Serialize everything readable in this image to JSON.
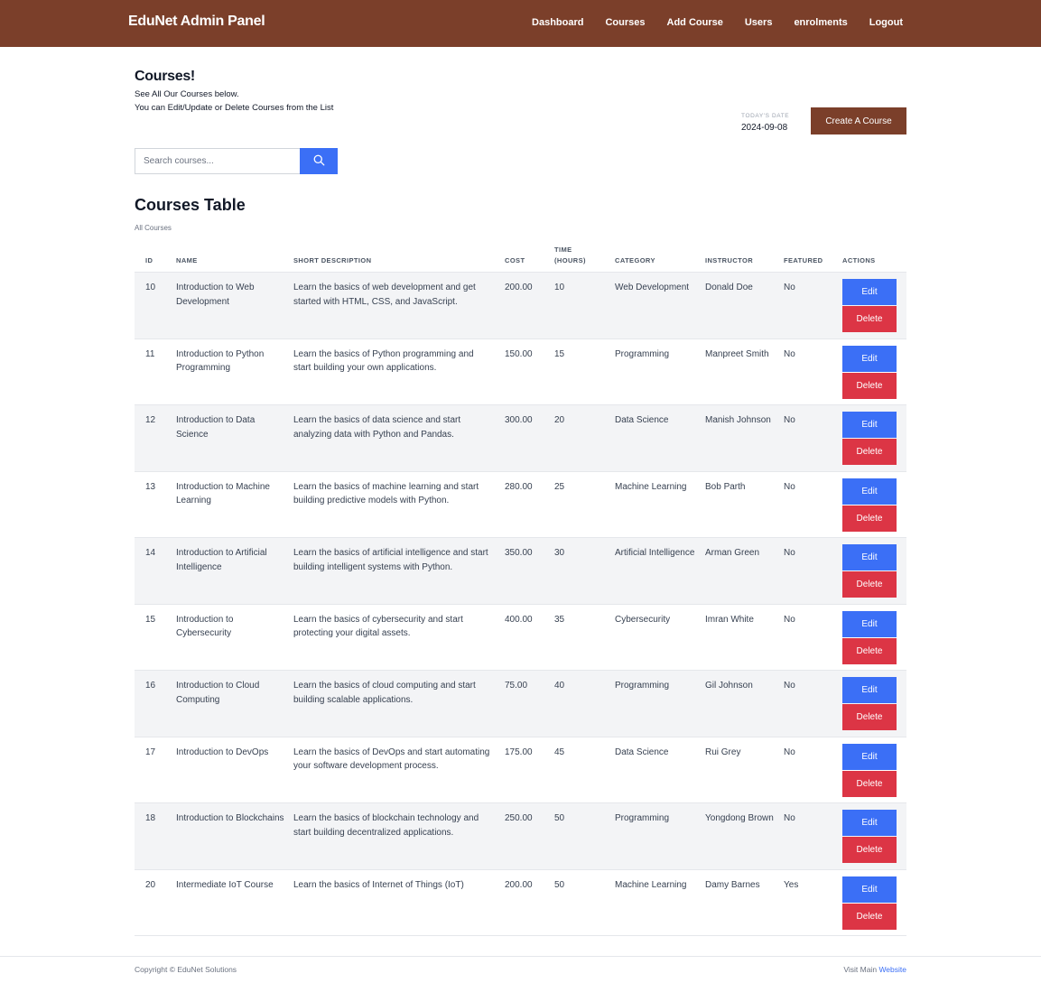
{
  "navbar": {
    "brand": "EduNet Admin Panel",
    "links": [
      "Dashboard",
      "Courses",
      "Add Course",
      "Users",
      "enrolments",
      "Logout"
    ]
  },
  "header": {
    "title": "Courses!",
    "subtitle_1": "See All Our Courses below.",
    "subtitle_2": "You can Edit/Update or Delete Courses from the List",
    "date_label": "Today's Date",
    "date_value": "2024-09-08",
    "create_button": "Create A Course"
  },
  "search": {
    "placeholder": "Search courses...",
    "icon": "search-icon"
  },
  "table": {
    "title": "Courses Table",
    "subtitle": "All Courses",
    "columns": [
      "ID",
      "Name",
      "Short Description",
      "Cost",
      "Time (Hours)",
      "Category",
      "Instructor",
      "Featured",
      "Actions"
    ],
    "edit_label": "Edit",
    "delete_label": "Delete",
    "rows": [
      {
        "id": "10",
        "name": "Introduction to Web Development",
        "desc": "Learn the basics of web development and get started with HTML, CSS, and JavaScript.",
        "cost": "200.00",
        "time": "10",
        "category": "Web Development",
        "instructor": "Donald Doe",
        "featured": "No"
      },
      {
        "id": "11",
        "name": "Introduction to Python Programming",
        "desc": "Learn the basics of Python programming and start building your own applications.",
        "cost": "150.00",
        "time": "15",
        "category": "Programming",
        "instructor": "Manpreet Smith",
        "featured": "No"
      },
      {
        "id": "12",
        "name": "Introduction to Data Science",
        "desc": "Learn the basics of data science and start analyzing data with Python and Pandas.",
        "cost": "300.00",
        "time": "20",
        "category": "Data Science",
        "instructor": "Manish Johnson",
        "featured": "No"
      },
      {
        "id": "13",
        "name": "Introduction to Machine Learning",
        "desc": "Learn the basics of machine learning and start building predictive models with Python.",
        "cost": "280.00",
        "time": "25",
        "category": "Machine Learning",
        "instructor": "Bob Parth",
        "featured": "No"
      },
      {
        "id": "14",
        "name": "Introduction to Artificial Intelligence",
        "desc": "Learn the basics of artificial intelligence and start building intelligent systems with Python.",
        "cost": "350.00",
        "time": "30",
        "category": "Artificial Intelligence",
        "instructor": "Arman Green",
        "featured": "No"
      },
      {
        "id": "15",
        "name": "Introduction to Cybersecurity",
        "desc": "Learn the basics of cybersecurity and start protecting your digital assets.",
        "cost": "400.00",
        "time": "35",
        "category": "Cybersecurity",
        "instructor": "Imran White",
        "featured": "No"
      },
      {
        "id": "16",
        "name": "Introduction to Cloud Computing",
        "desc": "Learn the basics of cloud computing and start building scalable applications.",
        "cost": "75.00",
        "time": "40",
        "category": "Programming",
        "instructor": "Gil Johnson",
        "featured": "No"
      },
      {
        "id": "17",
        "name": "Introduction to DevOps",
        "desc": "Learn the basics of DevOps and start automating your software development process.",
        "cost": "175.00",
        "time": "45",
        "category": "Data Science",
        "instructor": "Rui Grey",
        "featured": "No"
      },
      {
        "id": "18",
        "name": "Introduction to Blockchains",
        "desc": "Learn the basics of blockchain technology and start building decentralized applications.",
        "cost": "250.00",
        "time": "50",
        "category": "Programming",
        "instructor": "Yongdong Brown",
        "featured": "No"
      },
      {
        "id": "20",
        "name": "Intermediate IoT Course",
        "desc": "Learn the basics of Internet of Things (IoT)",
        "cost": "200.00",
        "time": "50",
        "category": "Machine Learning",
        "instructor": "Damy Barnes",
        "featured": "Yes"
      }
    ]
  },
  "footer": {
    "copyright": "Copyright © EduNet Solutions",
    "visit_prefix": "Visit Main",
    "visit_link": "Website"
  },
  "colors": {
    "brand": "#7b3f2a",
    "primary": "#3b6ff6",
    "danger": "#dc3545",
    "stripe": "#f3f4f6"
  }
}
